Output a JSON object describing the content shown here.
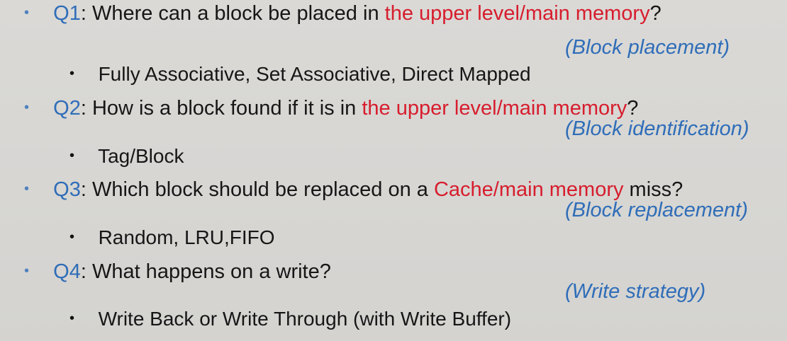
{
  "slide": {
    "items": [
      {
        "question": {
          "label": "Q1",
          "before": ": Where can a block be placed in ",
          "highlight": "the upper level/main memory",
          "after": "?"
        },
        "tag": "(Block placement)",
        "answer": "Fully Associative, Set Associative, Direct Mapped"
      },
      {
        "question": {
          "label": "Q2",
          "before": ": How is a block found if it is in ",
          "highlight": "the upper level/main memory",
          "after": "?"
        },
        "tag": "(Block identification)",
        "answer": "Tag/Block"
      },
      {
        "question": {
          "label": "Q3",
          "before": ": Which block should be replaced on a ",
          "highlight": "Cache/main memory",
          "after": " miss?"
        },
        "tag": "(Block replacement)",
        "answer": "Random, LRU,FIFO"
      },
      {
        "question": {
          "label": "Q4",
          "before": ": What happens on a write?",
          "highlight": "",
          "after": ""
        },
        "tag": "(Write strategy)",
        "answer": "Write Back or Write Through (with Write Buffer)"
      }
    ]
  },
  "colors": {
    "background": "#d9d8d5",
    "question_label": "#2f6db8",
    "highlight": "#d71d2d",
    "tag": "#2f6db8",
    "text": "#161616",
    "bullet": "#4f81bd"
  },
  "bullets": {
    "question": "•",
    "answer": "•"
  }
}
